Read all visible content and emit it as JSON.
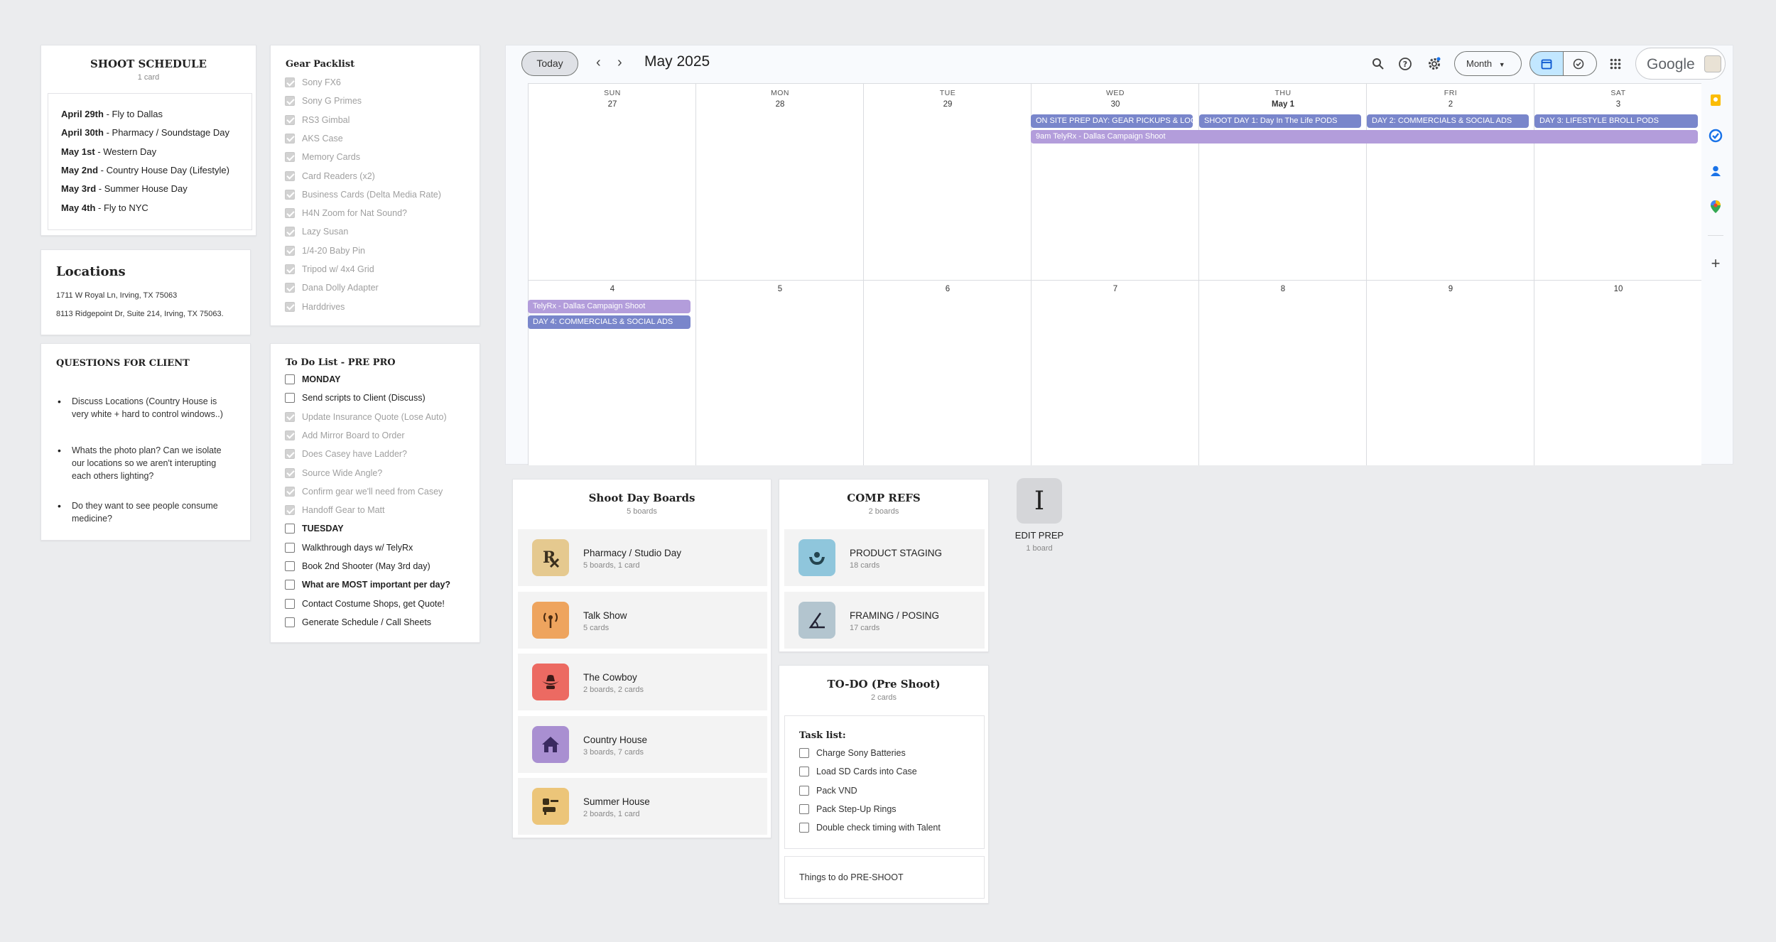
{
  "schedule": {
    "title": "SHOOT SCHEDULE",
    "sub": "1 card",
    "rows": [
      {
        "date": "April 29th",
        "text": " - Fly to Dallas"
      },
      {
        "date": "April 30th",
        "text": " - Pharmacy / Soundstage Day"
      },
      {
        "date": "May 1st",
        "text": " - Western Day"
      },
      {
        "date": "May 2nd",
        "text": " - Country House Day (Lifestyle)"
      },
      {
        "date": "May 3rd",
        "text": " - Summer House Day"
      },
      {
        "date": "May 4th",
        "text": " - Fly to NYC"
      }
    ]
  },
  "locations": {
    "title": "Locations",
    "lines": [
      "1711 W Royal Ln, Irving, TX 75063",
      "8113 Ridgepoint Dr, Suite 214, Irving, TX 75063."
    ]
  },
  "questions": {
    "title": "QUESTIONS FOR CLIENT",
    "items": [
      "Discuss Locations (Country House is very white + hard to control windows..)",
      "Whats the photo plan? Can we isolate our locations so we aren't interupting each others lighting?",
      "Do they want to see people consume medicine?"
    ]
  },
  "gear": {
    "title": "Gear Packlist",
    "items": [
      "Sony FX6",
      "Sony G Primes",
      "RS3 Gimbal",
      "AKS Case",
      "Memory Cards",
      "Card Readers (x2)",
      "Business Cards (Delta Media Rate)",
      "H4N Zoom for Nat Sound?",
      "Lazy Susan",
      "1/4-20 Baby Pin",
      "Tripod w/ 4x4 Grid",
      "Dana Dolly Adapter",
      "Harddrives"
    ]
  },
  "todo": {
    "title": "To Do List - PRE PRO",
    "items": [
      {
        "text": "MONDAY",
        "state": "bold"
      },
      {
        "text": "Send scripts to Client (Discuss)",
        "state": "open"
      },
      {
        "text": "Update Insurance Quote (Lose Auto)",
        "state": "done"
      },
      {
        "text": "Add Mirror Board to Order",
        "state": "done"
      },
      {
        "text": "Does Casey have Ladder?",
        "state": "done"
      },
      {
        "text": "Source Wide Angle?",
        "state": "done"
      },
      {
        "text": "Confirm gear we'll need from Casey",
        "state": "done"
      },
      {
        "text": "Handoff Gear to Matt",
        "state": "done"
      },
      {
        "text": "TUESDAY",
        "state": "bold"
      },
      {
        "text": "Walkthrough days w/ TelyRx",
        "state": "open"
      },
      {
        "text": "Book 2nd Shooter (May 3rd day)",
        "state": "open"
      },
      {
        "text": "What are MOST important per day?",
        "state": "bold"
      },
      {
        "text": "Contact Costume Shops, get Quote!",
        "state": "open"
      },
      {
        "text": "Generate Schedule / Call Sheets",
        "state": "open"
      }
    ]
  },
  "calendar": {
    "today": "Today",
    "month": "May 2025",
    "view": "Month",
    "brand": "Google",
    "dows": [
      "SUN",
      "MON",
      "TUE",
      "WED",
      "THU",
      "FRI",
      "SAT"
    ],
    "week1": [
      "27",
      "28",
      "29",
      "30",
      "May 1",
      "2",
      "3"
    ],
    "week2": [
      "4",
      "5",
      "6",
      "7",
      "8",
      "9",
      "10"
    ],
    "events": [
      "ON SITE PREP DAY: GEAR PICKUPS & LOCATION",
      "SHOOT DAY 1: Day In The Life PODS",
      "DAY 2: COMMERCIALS & SOCIAL ADS",
      "DAY 3: LIFESTYLE BROLL PODS",
      "9am TelyRx - Dallas Campaign Shoot",
      "TelyRx - Dallas Campaign Shoot",
      "DAY 4: COMMERCIALS & SOCIAL ADS"
    ],
    "colors": {
      "blue": "#7986cb",
      "purple": "#b39ddb"
    }
  },
  "boards": {
    "title": "Shoot Day Boards",
    "sub": "5 boards",
    "items": [
      {
        "name": "Pharmacy / Studio Day",
        "sub": "5 boards, 1 card",
        "icon": "rx-icon",
        "color": "#e5c98f"
      },
      {
        "name": "Talk Show",
        "sub": "5 cards",
        "icon": "antenna-icon",
        "color": "#eea45e"
      },
      {
        "name": "The Cowboy",
        "sub": "2 boards, 2 cards",
        "icon": "cowboy-icon",
        "color": "#ec6a62"
      },
      {
        "name": "Country House",
        "sub": "3 boards, 7 cards",
        "icon": "house-icon",
        "color": "#a98fd1"
      },
      {
        "name": "Summer House",
        "sub": "2 boards, 1 card",
        "icon": "sofa-icon",
        "color": "#ecc579"
      }
    ]
  },
  "comp": {
    "title": "COMP REFS",
    "sub": "2 boards",
    "items": [
      {
        "name": "PRODUCT STAGING",
        "sub": "18 cards",
        "icon": "hands-icon",
        "color": "#8fc6dc"
      },
      {
        "name": "FRAMING / POSING",
        "sub": "17 cards",
        "icon": "angle-icon",
        "color": "#b3c5cf"
      }
    ]
  },
  "todoShoot": {
    "title": "TO-DO (Pre Shoot)",
    "sub": "2 cards",
    "listTitle": "Task list:",
    "items": [
      "Charge Sony Batteries",
      "Load SD Cards into Case",
      "Pack VND",
      "Pack Step-Up Rings",
      "Double check timing with Talent"
    ],
    "note": "Things to do PRE-SHOOT"
  },
  "edit": {
    "name": "EDIT PREP",
    "sub": "1 board"
  }
}
